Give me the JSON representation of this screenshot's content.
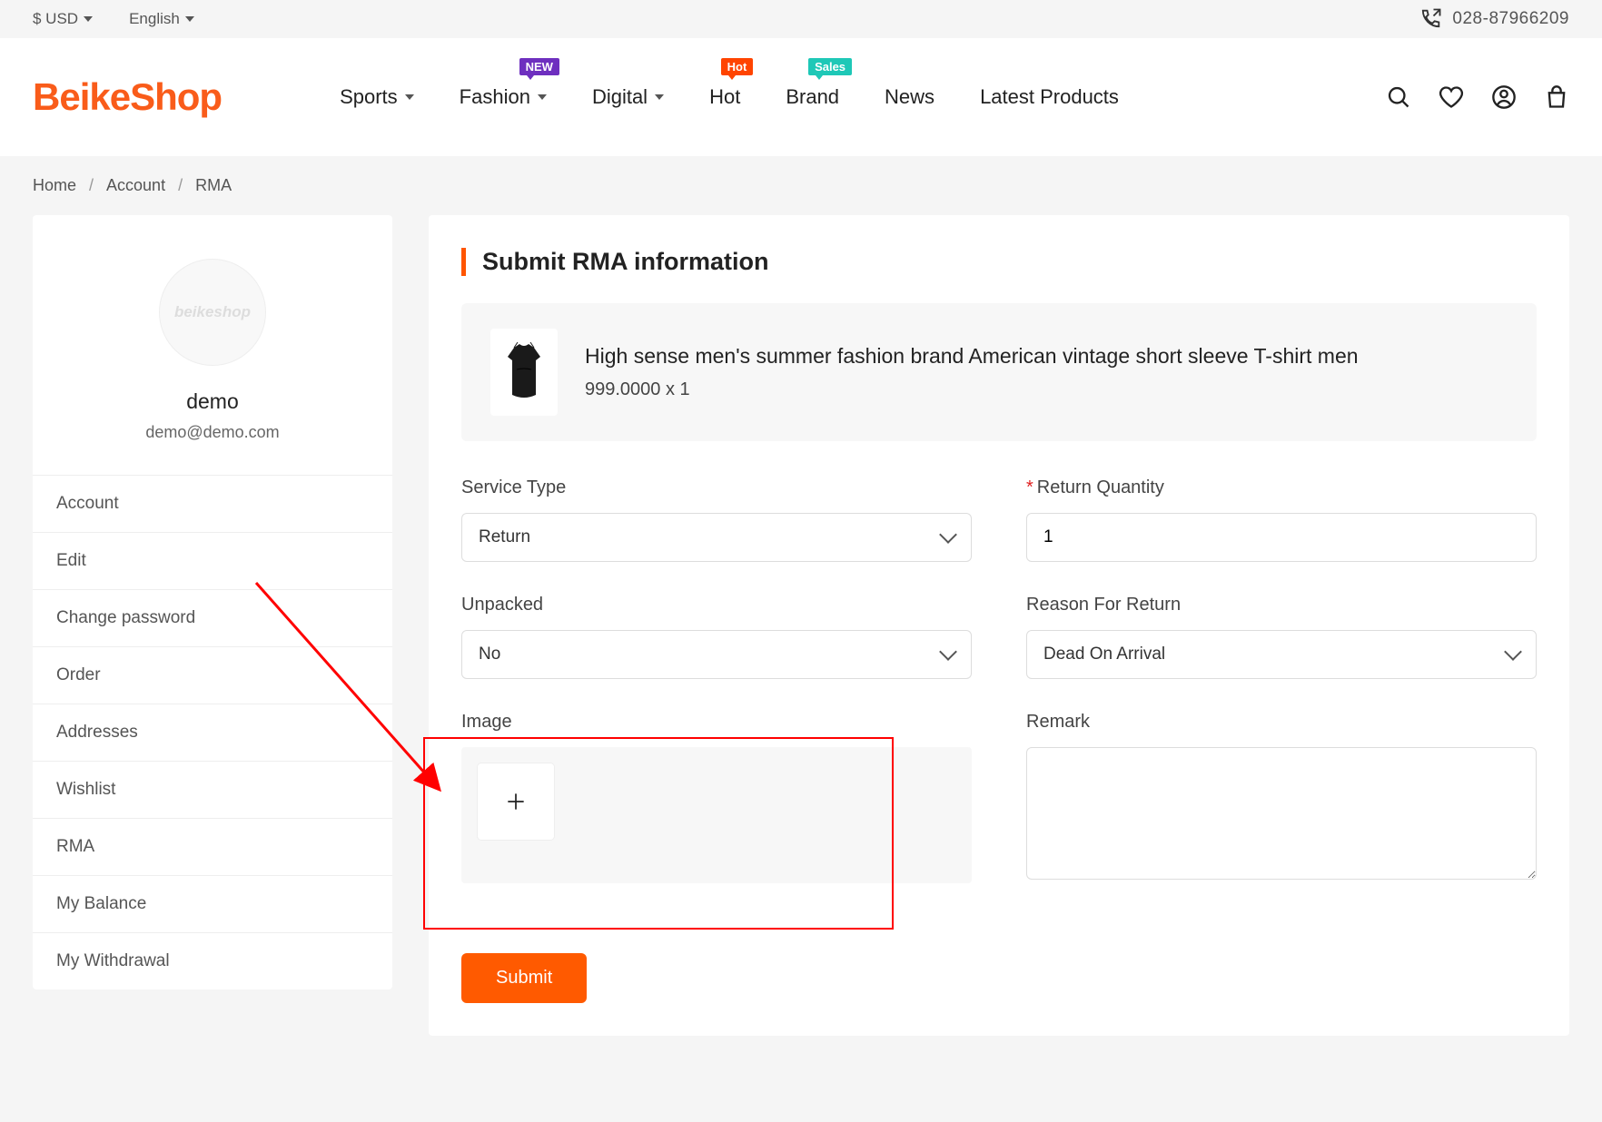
{
  "topbar": {
    "currency": "$ USD",
    "language": "English",
    "phone": "028-87966209"
  },
  "logo": "BeikeShop",
  "nav": {
    "items": [
      {
        "label": "Sports",
        "dropdown": true
      },
      {
        "label": "Fashion",
        "dropdown": true,
        "badge": "NEW",
        "badgeClass": "badge-new"
      },
      {
        "label": "Digital",
        "dropdown": true
      },
      {
        "label": "Hot",
        "badge": "Hot",
        "badgeClass": "badge-hot"
      },
      {
        "label": "Brand",
        "badge": "Sales",
        "badgeClass": "badge-sales"
      },
      {
        "label": "News"
      },
      {
        "label": "Latest Products"
      }
    ]
  },
  "breadcrumb": {
    "home": "Home",
    "account": "Account",
    "current": "RMA"
  },
  "profile": {
    "avatar_text": "beikeshop",
    "name": "demo",
    "email": "demo@demo.com"
  },
  "sidebar": {
    "items": [
      "Account",
      "Edit",
      "Change password",
      "Order",
      "Addresses",
      "Wishlist",
      "RMA",
      "My Balance",
      "My Withdrawal"
    ]
  },
  "panel": {
    "title": "Submit RMA information"
  },
  "product": {
    "name": "High sense men's summer fashion brand American vintage short sleeve T-shirt men",
    "price_qty": "999.0000 x 1"
  },
  "form": {
    "service_type_label": "Service Type",
    "service_type_value": "Return",
    "return_qty_label": "Return Quantity",
    "return_qty_value": "1",
    "unpacked_label": "Unpacked",
    "unpacked_value": "No",
    "reason_label": "Reason For Return",
    "reason_value": "Dead On Arrival",
    "image_label": "Image",
    "remark_label": "Remark",
    "submit": "Submit"
  }
}
